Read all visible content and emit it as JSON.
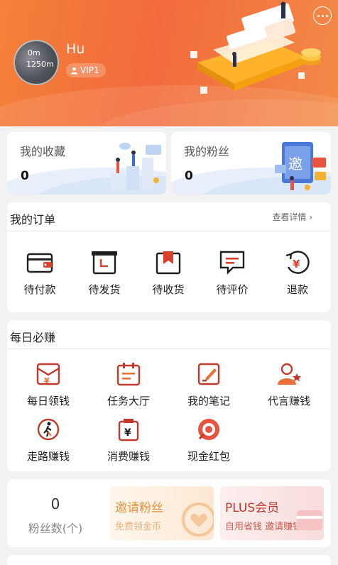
{
  "profile": {
    "username": "Hu",
    "vip_badge": "VIP1",
    "avatar_text_1": "0m",
    "avatar_text_2": "1250m"
  },
  "stats": {
    "favorites": {
      "title": "我的收藏",
      "value": "0"
    },
    "fans": {
      "title": "我的粉丝",
      "value": "0"
    }
  },
  "orders": {
    "title": "我的订单",
    "detail_link": "查看详情",
    "items": [
      {
        "label": "待付款",
        "icon": "wallet-icon"
      },
      {
        "label": "待发货",
        "icon": "box-ship-icon"
      },
      {
        "label": "待收货",
        "icon": "receive-icon"
      },
      {
        "label": "待评价",
        "icon": "comment-icon"
      },
      {
        "label": "退款",
        "icon": "refund-icon"
      }
    ]
  },
  "daily": {
    "title": "每日必赚",
    "items": [
      {
        "label": "每日领钱",
        "icon": "money-envelope-icon"
      },
      {
        "label": "任务大厅",
        "icon": "calendar-task-icon"
      },
      {
        "label": "我的笔记",
        "icon": "note-icon"
      },
      {
        "label": "代言赚钱",
        "icon": "endorse-person-icon"
      },
      {
        "label": "走路赚钱",
        "icon": "walk-icon"
      },
      {
        "label": "消费赚钱",
        "icon": "consume-icon"
      },
      {
        "label": "现金红包",
        "icon": "cash-redpacket-icon"
      }
    ]
  },
  "fans_promo": {
    "count": "0",
    "count_label": "粉丝数(个)",
    "invite_title": "邀请粉丝",
    "invite_sub": "免费领金币",
    "plus_title": "PLUS会员",
    "plus_sub": "自用省钱 邀请赚钱"
  },
  "colors": {
    "accent": "#f26b3c",
    "icon_red": "#c0392b",
    "icon_orange": "#e8703a",
    "plus_text": "#c0392b",
    "invite_text": "#e8933f"
  }
}
